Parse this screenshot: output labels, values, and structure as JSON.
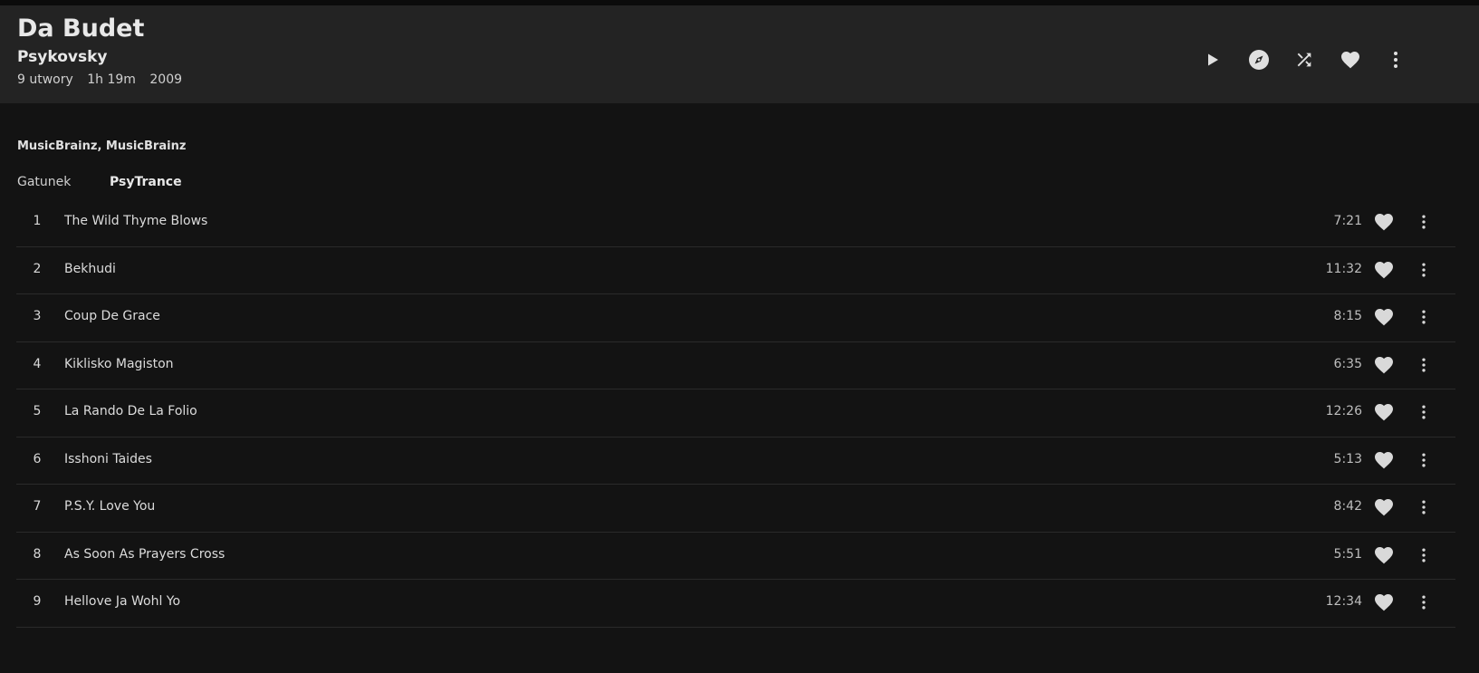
{
  "album": {
    "title": "Da Budet",
    "artist": "Psykovsky",
    "track_count": "9 utwory",
    "duration": "1h 19m",
    "year": "2009"
  },
  "header_actions": [
    {
      "name": "play-icon"
    },
    {
      "name": "compass-icon"
    },
    {
      "name": "shuffle-icon"
    },
    {
      "name": "heart-icon"
    },
    {
      "name": "more-vertical-icon"
    }
  ],
  "credits": "MusicBrainz, MusicBrainz",
  "genre": {
    "label": "Gatunek",
    "value": "PsyTrance"
  },
  "tracks": [
    {
      "num": "1",
      "title": "The Wild Thyme Blows",
      "duration": "7:21"
    },
    {
      "num": "2",
      "title": "Bekhudi",
      "duration": "11:32"
    },
    {
      "num": "3",
      "title": "Coup De Grace",
      "duration": "8:15"
    },
    {
      "num": "4",
      "title": "Kiklisko Magiston",
      "duration": "6:35"
    },
    {
      "num": "5",
      "title": "La Rando De La Folio",
      "duration": "12:26"
    },
    {
      "num": "6",
      "title": "Isshoni Taides",
      "duration": "5:13"
    },
    {
      "num": "7",
      "title": "P.S.Y. Love You",
      "duration": "8:42"
    },
    {
      "num": "8",
      "title": "As Soon As Prayers Cross",
      "duration": "5:51"
    },
    {
      "num": "9",
      "title": "Hellove Ja Wohl Yo",
      "duration": "12:34"
    }
  ],
  "colors": {
    "background": "#131313",
    "header_background": "#232323",
    "text": "#e6e6e6",
    "divider": "#2a2a2a"
  }
}
